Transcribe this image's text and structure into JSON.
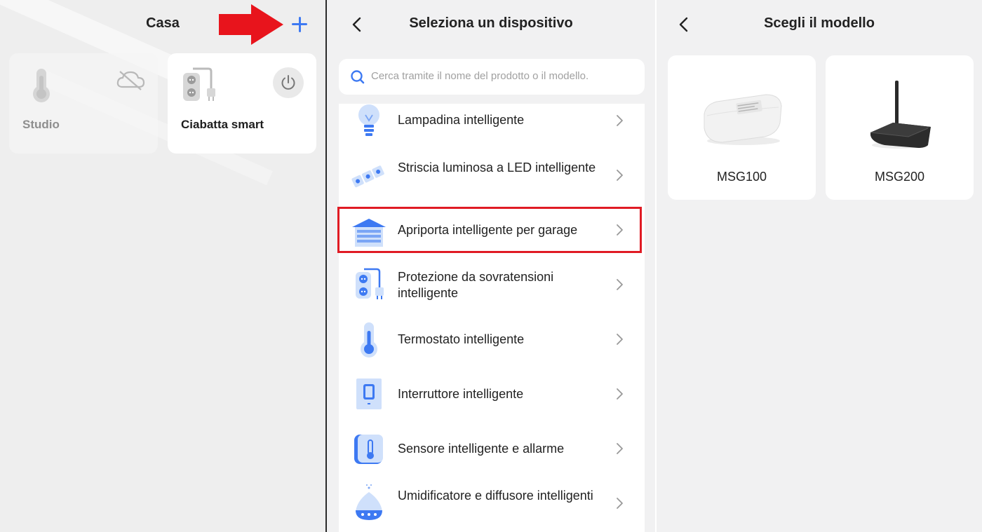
{
  "home": {
    "title": "Casa",
    "add_icon": "plus-icon",
    "devices": [
      {
        "name": "Studio",
        "icon": "thermometer-icon",
        "status_icon": "cloud-offline-icon"
      },
      {
        "name": "Ciabatta smart",
        "icon": "power-strip-icon",
        "status_icon": "power-icon"
      }
    ]
  },
  "select_device": {
    "title": "Seleziona un dispositivo",
    "search_placeholder": "Cerca tramite il nome del prodotto o il modello.",
    "items": [
      {
        "label": "Lampadina intelligente",
        "icon": "bulb-icon"
      },
      {
        "label": "Striscia luminosa a LED intelligente",
        "icon": "led-strip-icon"
      },
      {
        "label": "Apriporta intelligente per garage",
        "icon": "garage-door-icon"
      },
      {
        "label": "Protezione da sovratensioni intelligente",
        "icon": "surge-protector-icon"
      },
      {
        "label": "Termostato intelligente",
        "icon": "thermostat-icon"
      },
      {
        "label": "Interruttore intelligente",
        "icon": "switch-icon"
      },
      {
        "label": "Sensore intelligente e allarme",
        "icon": "sensor-icon"
      },
      {
        "label": "Umidificatore e diffusore intelligenti",
        "icon": "humidifier-icon"
      }
    ]
  },
  "choose_model": {
    "title": "Scegli il modello",
    "models": [
      {
        "name": "MSG100",
        "icon": "msg100-device-image"
      },
      {
        "name": "MSG200",
        "icon": "msg200-hub-image"
      }
    ]
  },
  "colors": {
    "accent": "#3d79f2",
    "highlight": "#e01b24",
    "arrow": "#e8141c"
  }
}
